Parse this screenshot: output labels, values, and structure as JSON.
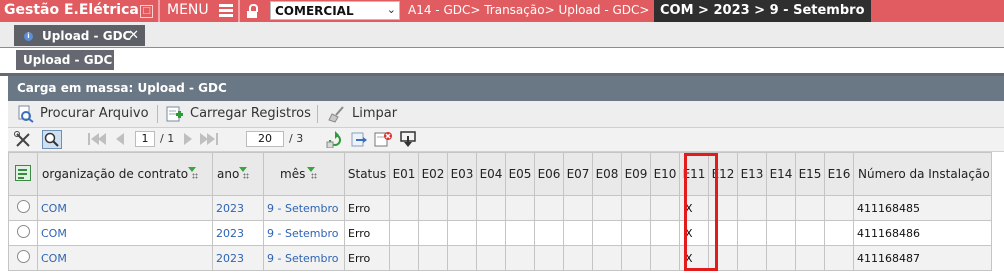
{
  "topbar": {
    "app_title": "Gestão E.Elétrica",
    "minimize_symbol": "□",
    "menu_label": "MENU",
    "company_select": {
      "value": "COMERCIAL",
      "arrow": "⌄"
    },
    "breadcrumb": "A14 - GDC> Transação> Upload - GDC>",
    "context": "COM > 2023 > 9 - Setembro"
  },
  "tabs": [
    {
      "label": "Upload - GDC",
      "close": "✕",
      "info": "i"
    }
  ],
  "subtab": {
    "label": "Upload - GDC"
  },
  "panel": {
    "title": "Carga em massa: Upload - GDC"
  },
  "actions": {
    "browse": "Procurar Arquivo",
    "load": "Carregar Registros",
    "clear": "Limpar"
  },
  "pager": {
    "current_page": "1",
    "page_sep": "/ 1",
    "rows_per_page": "20",
    "rows_sep": "/ 3"
  },
  "colors": {
    "topbar": "#e15c61",
    "panel_header": "#6a7785",
    "link": "#2d64b3",
    "highlight": "#e21b1b"
  },
  "grid": {
    "headers": [
      "organização de contrato",
      "ano",
      "mês",
      "Status",
      "E01",
      "E02",
      "E03",
      "E04",
      "E05",
      "E06",
      "E07",
      "E08",
      "E09",
      "E10",
      "E11",
      "E12",
      "E13",
      "E14",
      "E15",
      "E16",
      "Número da Instalação"
    ],
    "rows": [
      {
        "org": "COM",
        "ano": "2023",
        "mes": "9 - Setembro",
        "status": "Erro",
        "e11": "X",
        "instalacao": "411168485"
      },
      {
        "org": "COM",
        "ano": "2023",
        "mes": "9 - Setembro",
        "status": "Erro",
        "e11": "X",
        "instalacao": "411168486"
      },
      {
        "org": "COM",
        "ano": "2023",
        "mes": "9 - Setembro",
        "status": "Erro",
        "e11": "X",
        "instalacao": "411168487"
      }
    ]
  }
}
